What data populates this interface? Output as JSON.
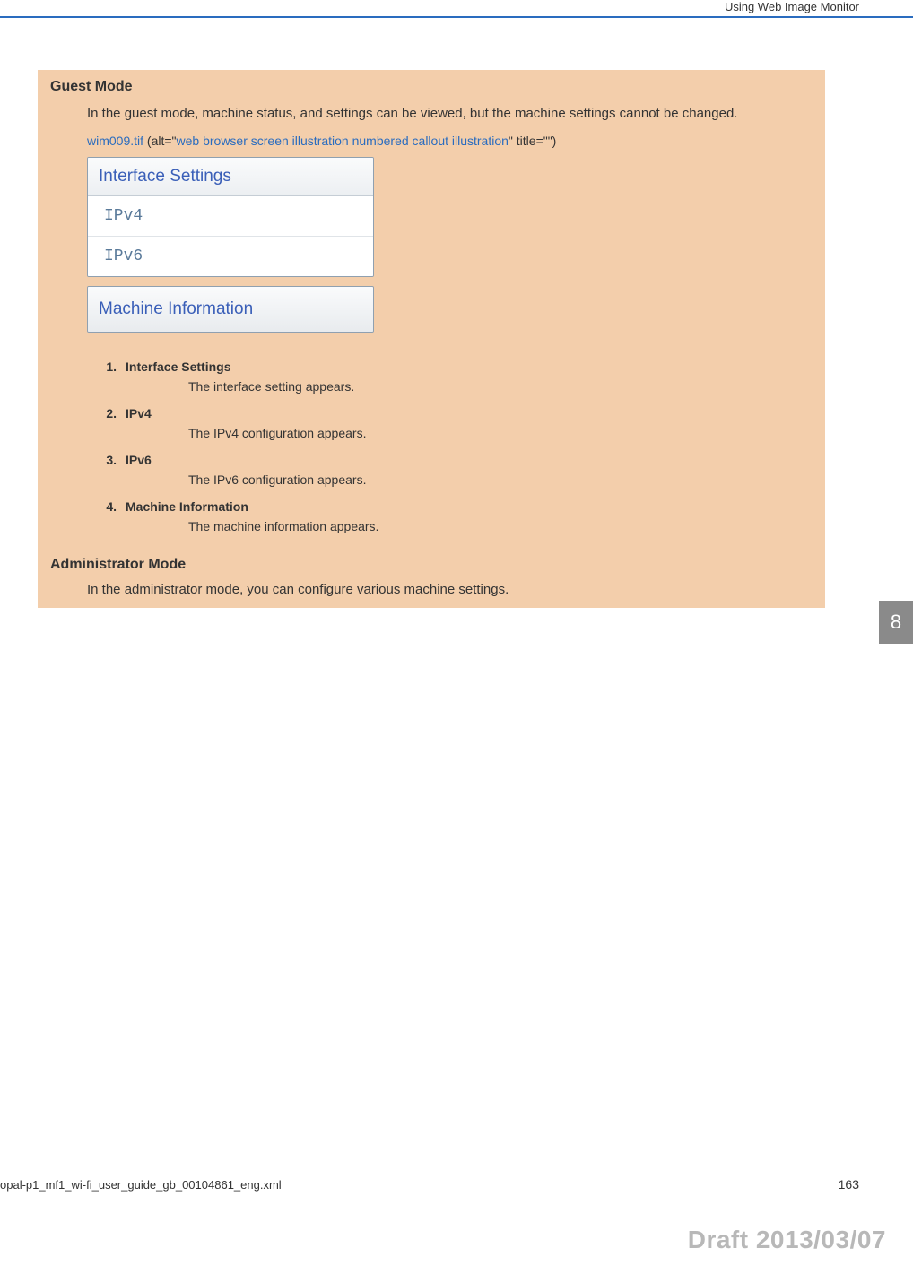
{
  "header": {
    "title": "Using Web Image Monitor"
  },
  "guest": {
    "heading": "Guest Mode",
    "body": "In the guest mode, machine status, and settings can be viewed, but the machine settings cannot be changed.",
    "ref_file": "wim009.tif",
    "ref_mid1": " (alt=\"",
    "ref_alt": "web browser screen illustration numbered callout illustration",
    "ref_mid2": "\" title=\"\")"
  },
  "illustration": {
    "group_header": "Interface Settings",
    "items": [
      "IPv4",
      "IPv6"
    ],
    "single": "Machine Information"
  },
  "list": [
    {
      "n": "1.",
      "title": "Interface Settings",
      "desc": "The interface setting appears."
    },
    {
      "n": "2.",
      "title": "IPv4",
      "desc": "The IPv4 configuration appears."
    },
    {
      "n": "3.",
      "title": "IPv6",
      "desc": "The IPv6 configuration appears."
    },
    {
      "n": "4.",
      "title": "Machine Information",
      "desc": "The machine information appears."
    }
  ],
  "admin": {
    "heading": "Administrator Mode",
    "body": "In the administrator mode, you can configure various machine settings."
  },
  "side_tab": "8",
  "footer": {
    "file": "opal-p1_mf1_wi-fi_user_guide_gb_00104861_eng.xml",
    "page": "163",
    "draft": "Draft 2013/03/07"
  }
}
